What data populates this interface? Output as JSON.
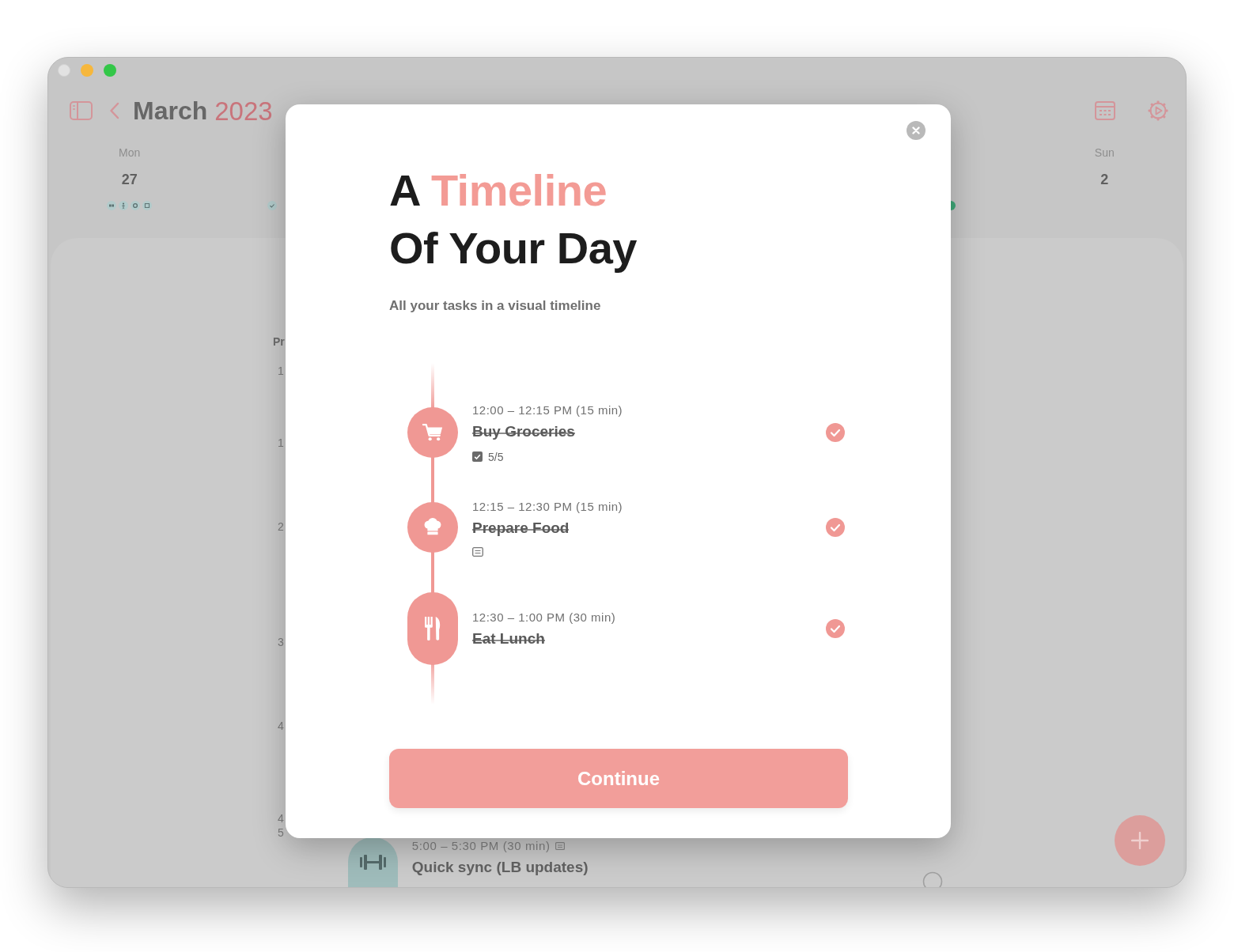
{
  "window": {
    "header": {
      "month": "March",
      "year": "2023"
    },
    "days": [
      {
        "weekday": "Mon",
        "date": "27"
      },
      {
        "weekday": "Sun",
        "date": "2"
      }
    ],
    "column_label": "Pr",
    "hour_labels": [
      "1",
      "1",
      "2",
      "3",
      "4",
      "4",
      "5"
    ],
    "background_task": {
      "time": "5:00 – 5:30 PM (30 min)",
      "title": "Quick sync (LB updates)",
      "done": false
    }
  },
  "dialog": {
    "title": {
      "lead": "A",
      "accent": "Timeline",
      "second_line": "Of Your Day"
    },
    "subtitle": "All your tasks in a visual timeline",
    "tasks": [
      {
        "time": "12:00 – 12:15 PM (15 min)",
        "title": "Buy Groceries",
        "done": true,
        "long": false,
        "kind": "checklist",
        "checked": true,
        "count": "5/5"
      },
      {
        "time": "12:15 – 12:30 PM (15 min)",
        "title": "Prepare Food",
        "done": true,
        "long": false,
        "kind": "note"
      },
      {
        "time": "12:30 – 1:00 PM (30 min)",
        "title": "Eat Lunch",
        "done": true,
        "long": true,
        "kind": "plain"
      }
    ],
    "button": "Continue"
  }
}
